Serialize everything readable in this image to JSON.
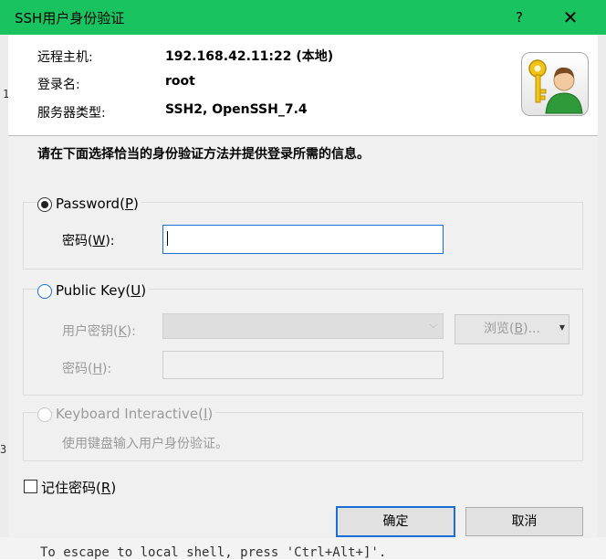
{
  "window": {
    "title": "SSH用户身份验证",
    "help_glyph": "?",
    "close_glyph": "✕"
  },
  "host_info": {
    "remote_host_label": "远程主机:",
    "remote_host_value": "192.168.42.11:22 (本地)",
    "login_label": "登录名:",
    "login_value": "root",
    "server_type_label": "服务器类型:",
    "server_type_value": "SSH2, OpenSSH_7.4"
  },
  "instruction": "请在下面选择恰当的身份验证方法并提供登录所需的信息。",
  "password_method": {
    "label": "Password",
    "accel": "P",
    "selected": true,
    "field_label": "密码",
    "field_accel": "W",
    "field_value": ""
  },
  "public_key_method": {
    "label": "Public Key",
    "accel": "U",
    "selected": false,
    "user_key_label": "用户密钥",
    "user_key_accel": "K",
    "browse_label": "浏览",
    "browse_accel": "B",
    "browse_suffix": "...",
    "passphrase_label": "密码",
    "passphrase_accel": "H"
  },
  "keyboard_method": {
    "label": "Keyboard Interactive",
    "accel": "I",
    "enabled": false,
    "description": "使用键盘输入用户身份验证。"
  },
  "remember": {
    "label": "记住密码",
    "accel": "R",
    "checked": false
  },
  "buttons": {
    "ok": "确定",
    "cancel": "取消"
  },
  "background": {
    "terminal_line": "To escape to local shell, press 'Ctrl+Alt+]'.",
    "left_fragment_1": "3.",
    "left_fragment_2": "1"
  },
  "colors": {
    "titlebar": "#19c360",
    "accent": "#1a6fd6",
    "dialog_bg": "#f0f0f0"
  }
}
